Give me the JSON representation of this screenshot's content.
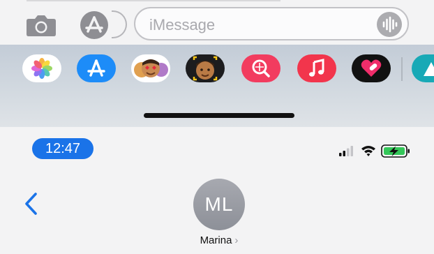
{
  "composer": {
    "placeholder": "iMessage",
    "camera_icon": "camera-icon",
    "apps_icon": "app-store-icon",
    "audio_icon": "audio-waveform-icon"
  },
  "app_drawer": {
    "apps": [
      {
        "name": "photos-app-icon",
        "bg": "#ffffff"
      },
      {
        "name": "app-store-app-icon",
        "bg": "#1d8cf8"
      },
      {
        "name": "memoji-stickers-icon",
        "bg": "#ffffff"
      },
      {
        "name": "memoji-icon",
        "bg": "#1c1c1e"
      },
      {
        "name": "image-search-icon",
        "bg": "#f23c5f"
      },
      {
        "name": "music-app-icon",
        "bg": "#f2354c"
      },
      {
        "name": "digital-touch-icon",
        "bg": "#111111"
      },
      {
        "name": "partial-app-icon",
        "bg": "#18a9b6"
      }
    ]
  },
  "status_bar": {
    "time": "12:47",
    "signal_icon": "cellular-signal-icon",
    "wifi_icon": "wifi-icon",
    "battery_icon": "battery-charging-icon"
  },
  "conversation": {
    "avatar_initials": "ML",
    "contact_name": "Marina",
    "contact_chevron": "›"
  },
  "colors": {
    "accent": "#1a73e8",
    "battery_green": "#34c759"
  }
}
